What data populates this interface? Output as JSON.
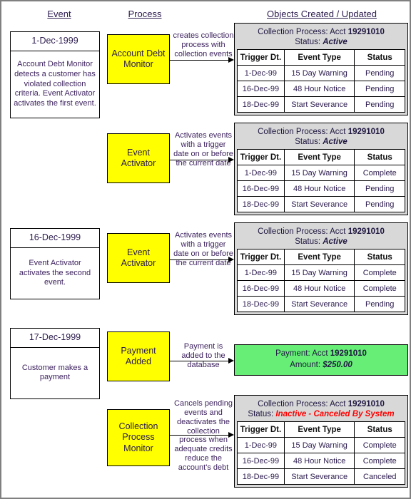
{
  "headers": {
    "event": "Event",
    "process": "Process",
    "objects": "Objects Created / Updated"
  },
  "rows": [
    {
      "event": {
        "date": "1-Dec-1999",
        "desc": "Account Debt Monitor detects a customer has violated collection criteria.  Event Activator activates the first event."
      },
      "process": "Account Debt Monitor",
      "arrow_caption": "creates collection process with collection events",
      "object": {
        "kind": "collection-process",
        "title_prefix": "Collection Process: Acct ",
        "account": "19291010",
        "status_label": "Status: ",
        "status_value": "Active",
        "status_color": "dark",
        "columns": [
          "Trigger Dt.",
          "Event Type",
          "Status"
        ],
        "rows": [
          {
            "date": "1-Dec-99",
            "type": "15 Day Warning",
            "status": "Pending",
            "status_color": "dark"
          },
          {
            "date": "16-Dec-99",
            "type": "48 Hour Notice",
            "status": "Pending",
            "status_color": "dark"
          },
          {
            "date": "18-Dec-99",
            "type": "Start Severance",
            "status": "Pending",
            "status_color": "dark"
          }
        ]
      }
    },
    {
      "event": null,
      "process": "Event Activator",
      "arrow_caption": "Activates events with a trigger date on or before the current date",
      "object": {
        "kind": "collection-process",
        "title_prefix": "Collection Process: Acct ",
        "account": "19291010",
        "status_label": "Status: ",
        "status_value": "Active",
        "status_color": "dark",
        "columns": [
          "Trigger Dt.",
          "Event Type",
          "Status"
        ],
        "rows": [
          {
            "date": "1-Dec-99",
            "type": "15 Day Warning",
            "status": "Complete",
            "status_color": "red"
          },
          {
            "date": "16-Dec-99",
            "type": "48 Hour Notice",
            "status": "Pending",
            "status_color": "dark"
          },
          {
            "date": "18-Dec-99",
            "type": "Start Severance",
            "status": "Pending",
            "status_color": "dark"
          }
        ]
      }
    },
    {
      "event": {
        "date": "16-Dec-1999",
        "desc": "Event Activator activates the second event."
      },
      "process": "Event Activator",
      "arrow_caption": "Activates events with a trigger date on or before the current date",
      "object": {
        "kind": "collection-process",
        "title_prefix": "Collection Process: Acct ",
        "account": "19291010",
        "status_label": "Status: ",
        "status_value": "Active",
        "status_color": "dark",
        "columns": [
          "Trigger Dt.",
          "Event Type",
          "Status"
        ],
        "rows": [
          {
            "date": "1-Dec-99",
            "type": "15 Day Warning",
            "status": "Complete",
            "status_color": "dark"
          },
          {
            "date": "16-Dec-99",
            "type": "48 Hour Notice",
            "status": "Complete",
            "status_color": "red"
          },
          {
            "date": "18-Dec-99",
            "type": "Start Severance",
            "status": "Pending",
            "status_color": "dark"
          }
        ]
      }
    },
    {
      "event": {
        "date": "17-Dec-1999",
        "desc": "Customer makes a payment"
      },
      "process": "Payment Added",
      "arrow_caption": "Payment is added to the database",
      "object": {
        "kind": "payment",
        "title_prefix": "Payment: Acct ",
        "account": "19291010",
        "amount_label": "Amount: ",
        "amount_value": "$250.00"
      }
    },
    {
      "event": null,
      "process": "Collection Process Monitor",
      "arrow_caption": "Cancels pending events and deactivates the collection process when adequate credits reduce the account's debt",
      "object": {
        "kind": "collection-process",
        "title_prefix": "Collection Process: Acct ",
        "account": "19291010",
        "status_label": "Status: ",
        "status_value": "Inactive - Canceled By System",
        "status_color": "red",
        "columns": [
          "Trigger Dt.",
          "Event Type",
          "Status"
        ],
        "rows": [
          {
            "date": "1-Dec-99",
            "type": "15 Day Warning",
            "status": "Complete",
            "status_color": "dark"
          },
          {
            "date": "16-Dec-99",
            "type": "48 Hour Notice",
            "status": "Complete",
            "status_color": "dark"
          },
          {
            "date": "18-Dec-99",
            "type": "Start Severance",
            "status": "Canceled",
            "status_color": "red"
          }
        ]
      }
    }
  ],
  "colors": {
    "process_fill": "#ffff00",
    "panel_fill": "#d8d8d8",
    "payment_fill": "#66ee77",
    "status_alert": "#ff0000",
    "text": "#2b1b4d"
  }
}
